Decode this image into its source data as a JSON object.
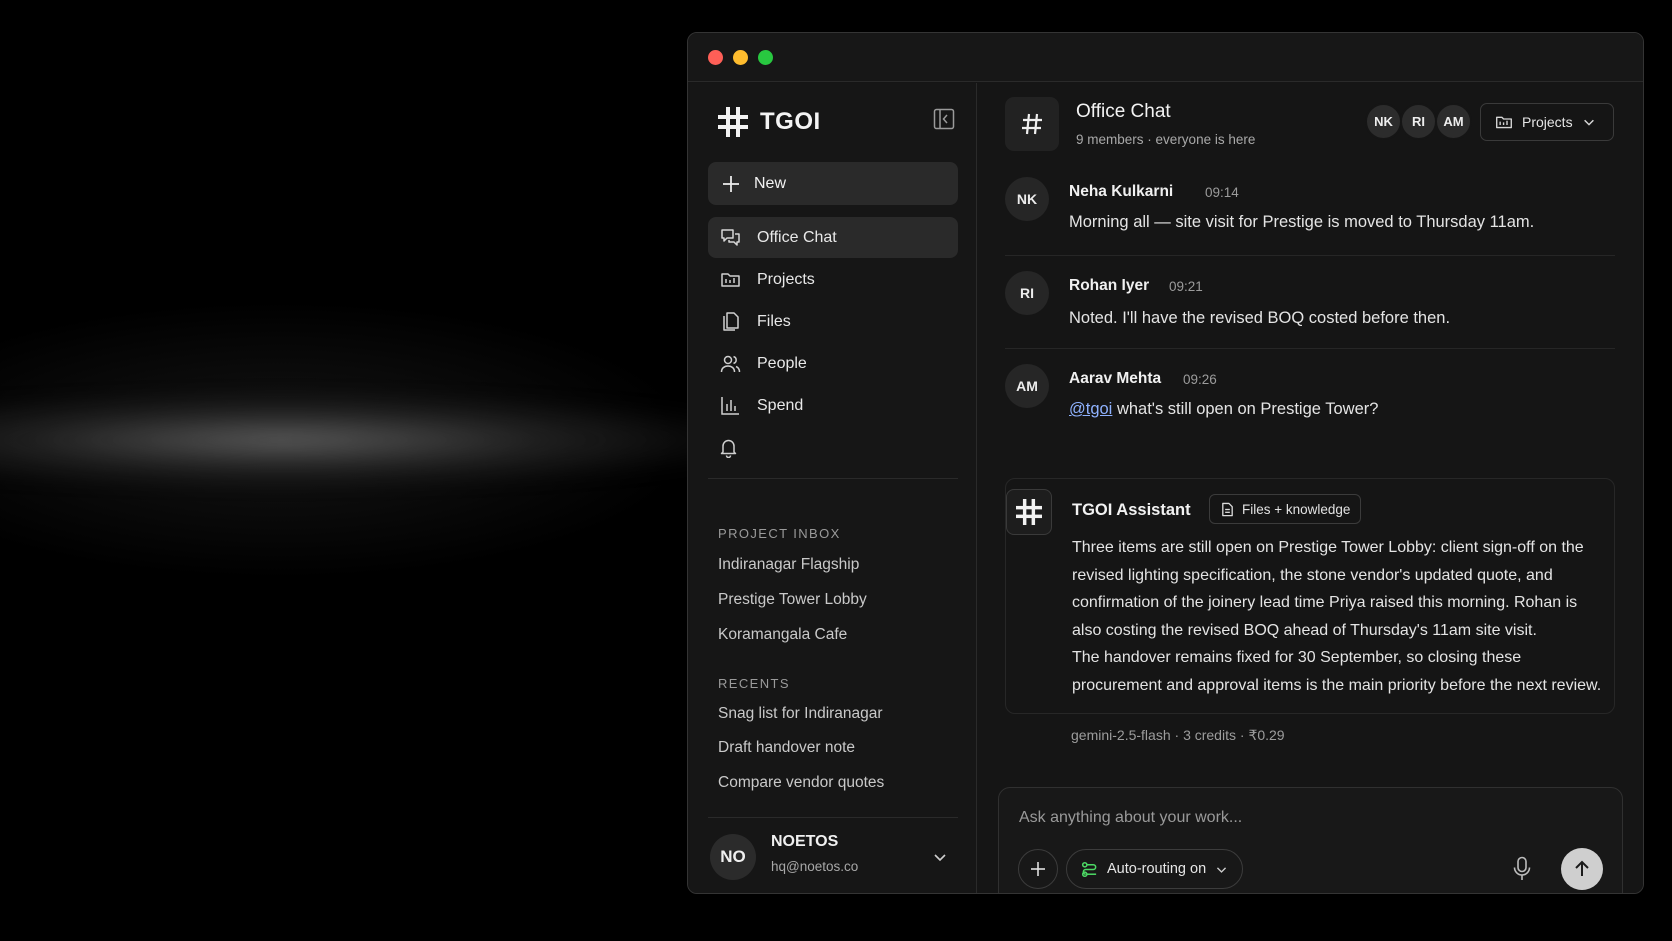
{
  "app": {
    "name": "TGOI"
  },
  "sidebar": {
    "new_label": "New",
    "nav": [
      {
        "label": "Office Chat",
        "icon": "chat-icon",
        "active": true
      },
      {
        "label": "Projects",
        "icon": "folder-icon",
        "active": false
      },
      {
        "label": "Files",
        "icon": "files-icon",
        "active": false
      },
      {
        "label": "People",
        "icon": "people-icon",
        "active": false
      },
      {
        "label": "Spend",
        "icon": "bar-chart-icon",
        "active": false
      }
    ],
    "project_inbox_title": "PROJECT INBOX",
    "projects": [
      "Indiranagar Flagship",
      "Prestige Tower Lobby",
      "Koramangala Cafe"
    ],
    "recents_title": "RECENTS",
    "recents": [
      "Snag list for Indiranagar",
      "Draft handover note",
      "Compare vendor quotes"
    ],
    "user": {
      "initials": "NO",
      "name": "NOETOS",
      "email": "hq@noetos.co"
    }
  },
  "channel": {
    "title": "Office Chat",
    "members": "9 members",
    "presence": "everyone is here",
    "avatars": [
      "NK",
      "RI",
      "AM"
    ],
    "projects_button": "Projects"
  },
  "messages": [
    {
      "initials": "NK",
      "name": "Neha Kulkarni",
      "time": "09:14",
      "text": "Morning all — site visit for Prestige is moved to Thursday 11am."
    },
    {
      "initials": "RI",
      "name": "Rohan Iyer",
      "time": "09:21",
      "text": "Noted. I'll have the revised BOQ costed before then."
    },
    {
      "initials": "AM",
      "name": "Aarav Mehta",
      "time": "09:26",
      "mention": "@tgoi",
      "text": " what's still open on Prestige Tower?"
    }
  ],
  "assistant": {
    "name": "TGOI Assistant",
    "badge": "Files + knowledge",
    "paragraph1": "Three items are still open on Prestige Tower Lobby: client sign-off on the revised lighting specification, the stone vendor's updated quote, and confirmation of the joinery lead time Priya raised this morning. Rohan is also costing the revised BOQ ahead of Thursday's 11am site visit.",
    "paragraph2": "The handover remains fixed for 30 September, so closing these procurement and approval items is the main priority before the next review.",
    "model": "gemini-2.5-flash",
    "credits": "3 credits",
    "cost": "₹0.29"
  },
  "composer": {
    "placeholder": "Ask anything about your work...",
    "routing_label": "Auto-routing on"
  },
  "colors": {
    "mention": "#8fb2ff",
    "routing_icon": "#4cd964"
  }
}
